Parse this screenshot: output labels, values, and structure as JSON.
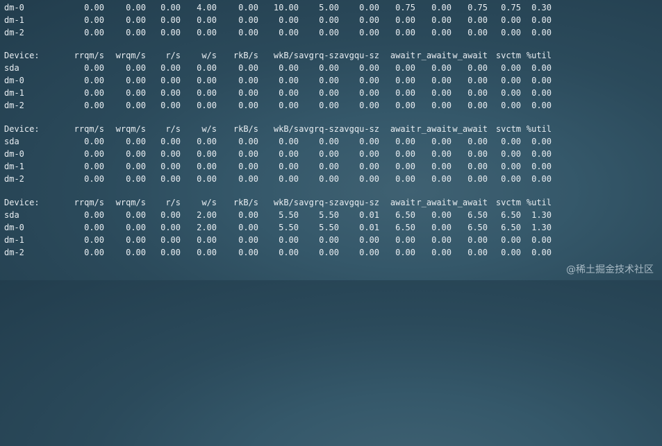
{
  "terminal": {
    "top_block": [
      {
        "device": "dm-0",
        "values": [
          "0.00",
          "0.00",
          "0.00",
          "4.00",
          "0.00",
          "10.00",
          "5.00",
          "0.00",
          "0.75",
          "0.00",
          "0.75",
          "0.75",
          "0.30"
        ]
      },
      {
        "device": "dm-1",
        "values": [
          "0.00",
          "0.00",
          "0.00",
          "0.00",
          "0.00",
          "0.00",
          "0.00",
          "0.00",
          "0.00",
          "0.00",
          "0.00",
          "0.00",
          "0.00"
        ]
      },
      {
        "device": "dm-2",
        "values": [
          "0.00",
          "0.00",
          "0.00",
          "0.00",
          "0.00",
          "0.00",
          "0.00",
          "0.00",
          "0.00",
          "0.00",
          "0.00",
          "0.00",
          "0.00"
        ]
      }
    ],
    "blocks": [
      {
        "header": [
          "Device:",
          "rrqm/s",
          "wrqm/s",
          "r/s",
          "w/s",
          "rkB/s",
          "wkB/s",
          "avgrq-sz",
          "avgqu-sz",
          "await",
          "r_await",
          "w_await",
          "svctm",
          "%util"
        ],
        "rows": [
          {
            "device": "sda",
            "values": [
              "0.00",
              "0.00",
              "0.00",
              "0.00",
              "0.00",
              "0.00",
              "0.00",
              "0.00",
              "0.00",
              "0.00",
              "0.00",
              "0.00",
              "0.00"
            ]
          },
          {
            "device": "dm-0",
            "values": [
              "0.00",
              "0.00",
              "0.00",
              "0.00",
              "0.00",
              "0.00",
              "0.00",
              "0.00",
              "0.00",
              "0.00",
              "0.00",
              "0.00",
              "0.00"
            ]
          },
          {
            "device": "dm-1",
            "values": [
              "0.00",
              "0.00",
              "0.00",
              "0.00",
              "0.00",
              "0.00",
              "0.00",
              "0.00",
              "0.00",
              "0.00",
              "0.00",
              "0.00",
              "0.00"
            ]
          },
          {
            "device": "dm-2",
            "values": [
              "0.00",
              "0.00",
              "0.00",
              "0.00",
              "0.00",
              "0.00",
              "0.00",
              "0.00",
              "0.00",
              "0.00",
              "0.00",
              "0.00",
              "0.00"
            ]
          }
        ]
      },
      {
        "header": [
          "Device:",
          "rrqm/s",
          "wrqm/s",
          "r/s",
          "w/s",
          "rkB/s",
          "wkB/s",
          "avgrq-sz",
          "avgqu-sz",
          "await",
          "r_await",
          "w_await",
          "svctm",
          "%util"
        ],
        "rows": [
          {
            "device": "sda",
            "values": [
              "0.00",
              "0.00",
              "0.00",
              "0.00",
              "0.00",
              "0.00",
              "0.00",
              "0.00",
              "0.00",
              "0.00",
              "0.00",
              "0.00",
              "0.00"
            ]
          },
          {
            "device": "dm-0",
            "values": [
              "0.00",
              "0.00",
              "0.00",
              "0.00",
              "0.00",
              "0.00",
              "0.00",
              "0.00",
              "0.00",
              "0.00",
              "0.00",
              "0.00",
              "0.00"
            ]
          },
          {
            "device": "dm-1",
            "values": [
              "0.00",
              "0.00",
              "0.00",
              "0.00",
              "0.00",
              "0.00",
              "0.00",
              "0.00",
              "0.00",
              "0.00",
              "0.00",
              "0.00",
              "0.00"
            ]
          },
          {
            "device": "dm-2",
            "values": [
              "0.00",
              "0.00",
              "0.00",
              "0.00",
              "0.00",
              "0.00",
              "0.00",
              "0.00",
              "0.00",
              "0.00",
              "0.00",
              "0.00",
              "0.00"
            ]
          }
        ]
      },
      {
        "header": [
          "Device:",
          "rrqm/s",
          "wrqm/s",
          "r/s",
          "w/s",
          "rkB/s",
          "wkB/s",
          "avgrq-sz",
          "avgqu-sz",
          "await",
          "r_await",
          "w_await",
          "svctm",
          "%util"
        ],
        "rows": [
          {
            "device": "sda",
            "values": [
              "0.00",
              "0.00",
              "0.00",
              "2.00",
              "0.00",
              "5.50",
              "5.50",
              "0.01",
              "6.50",
              "0.00",
              "6.50",
              "6.50",
              "1.30"
            ]
          },
          {
            "device": "dm-0",
            "values": [
              "0.00",
              "0.00",
              "0.00",
              "2.00",
              "0.00",
              "5.50",
              "5.50",
              "0.01",
              "6.50",
              "0.00",
              "6.50",
              "6.50",
              "1.30"
            ]
          },
          {
            "device": "dm-1",
            "values": [
              "0.00",
              "0.00",
              "0.00",
              "0.00",
              "0.00",
              "0.00",
              "0.00",
              "0.00",
              "0.00",
              "0.00",
              "0.00",
              "0.00",
              "0.00"
            ]
          },
          {
            "device": "dm-2",
            "values": [
              "0.00",
              "0.00",
              "0.00",
              "0.00",
              "0.00",
              "0.00",
              "0.00",
              "0.00",
              "0.00",
              "0.00",
              "0.00",
              "0.00",
              "0.00"
            ]
          }
        ]
      }
    ]
  },
  "watermark": {
    "text": "@稀土掘金技术社区"
  },
  "colors": {
    "text": "#e9eef2",
    "background": "#2f5162"
  }
}
